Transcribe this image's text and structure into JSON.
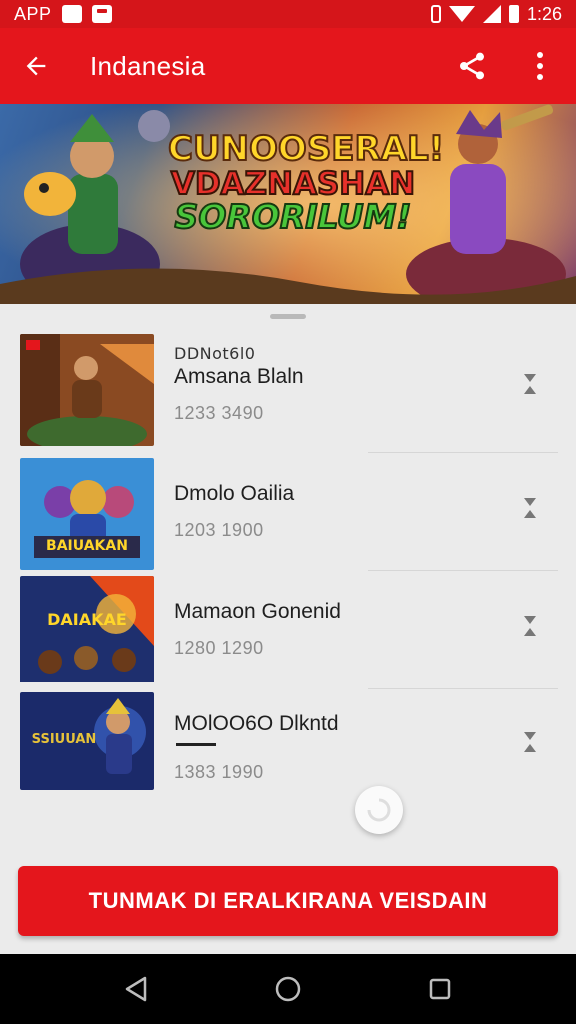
{
  "status_bar": {
    "app_label": "APP",
    "time": "1:26",
    "icons": [
      "notification-icon",
      "message-icon",
      "bluetooth-icon",
      "wifi-icon",
      "signal-icon",
      "battery-icon"
    ]
  },
  "app_bar": {
    "title": "Indanesia",
    "icons": [
      "back-arrow-icon",
      "share-icon",
      "more-vert-icon"
    ]
  },
  "banner": {
    "line1": "CUNOOSERAL!",
    "line2": "VDAZNASHAN",
    "line3": "SORORILUM!"
  },
  "games": [
    {
      "pre": "DDNot6l0",
      "name": "Amsana Blaln",
      "size": "1233 3490",
      "thumb_text": "",
      "thumb_colors": [
        "#8a4a22",
        "#e08a3c",
        "#3e6a2e"
      ]
    },
    {
      "pre": "",
      "name": "Dmolo Oailia",
      "size": "1203 1900",
      "thumb_text": "BAIUAKAN",
      "thumb_colors": [
        "#3a8fd6",
        "#7a3fa8",
        "#e0a93a"
      ]
    },
    {
      "pre": "",
      "name": "Mamaon Gonenid",
      "size": "1280 1290",
      "thumb_text": "DAIAKAE",
      "thumb_colors": [
        "#1e2f6e",
        "#e34a1a",
        "#f2b43a"
      ]
    },
    {
      "pre": "",
      "name": "MOlOO6O Dlkntd",
      "size": "1383 1990",
      "thumb_text": "SSIUUAN",
      "thumb_colors": [
        "#1b2a6a",
        "#3a64c8",
        "#e6c23a"
      ]
    }
  ],
  "cta": {
    "label": "TUNMAK DI ERALKIRANA VEISDAIN"
  },
  "theme": {
    "primary": "#e4161c",
    "status": "#d5151a",
    "sheet": "#ebebeb"
  },
  "nav_bar": {
    "icons": [
      "back-triangle-icon",
      "home-circle-icon",
      "recents-square-icon"
    ]
  }
}
